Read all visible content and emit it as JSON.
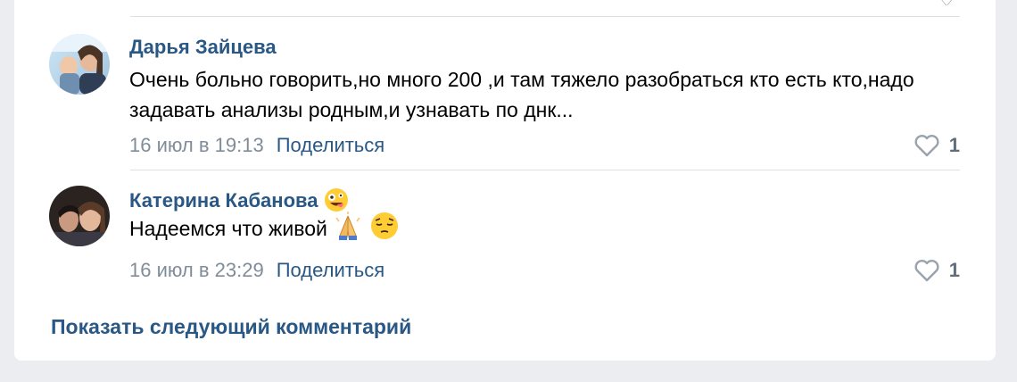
{
  "comments": [
    {
      "author": "Дарья Зайцева",
      "text": "Очень больно говорить,но много 200 ,и там тяжело разобраться кто есть кто,надо задавать анализы родным,и узнавать по днк...",
      "date": "16 июл в 19:13",
      "share_label": "Поделиться",
      "likes": "1"
    },
    {
      "author": "Катерина Кабанова",
      "author_emoji_icon": "crazy-face-emoji",
      "text": "Надеемся что живой",
      "text_emoji_icons": [
        "folded-hands-emoji",
        "pensive-face-emoji"
      ],
      "date": "16 июл в 23:29",
      "share_label": "Поделиться",
      "likes": "1"
    }
  ],
  "show_next_label": "Показать следующий комментарий",
  "colors": {
    "link": "#2a5885",
    "secondary": "#818c99",
    "divider": "#dce1e6",
    "background": "#ebedf0"
  }
}
